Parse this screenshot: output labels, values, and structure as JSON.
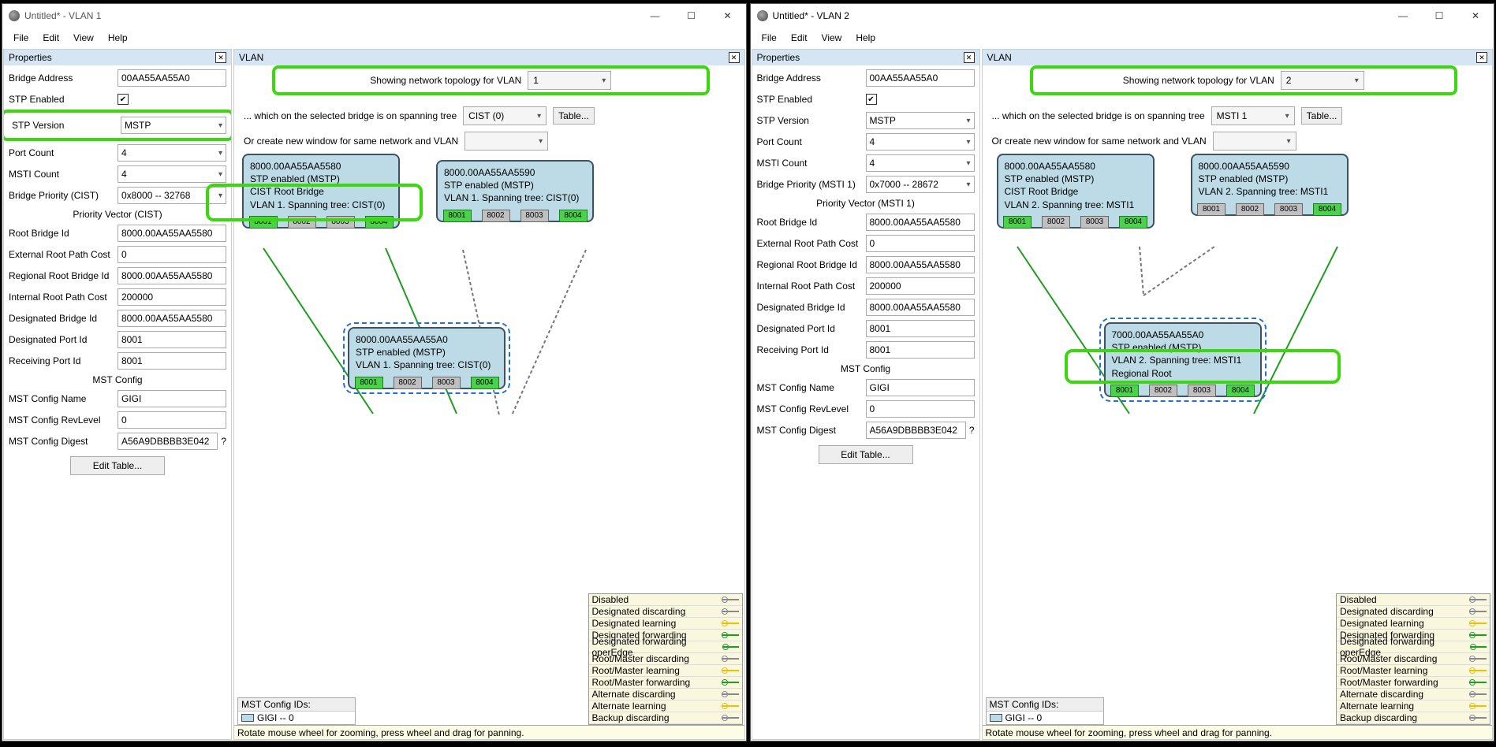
{
  "windows": [
    {
      "title": "Untitled* - VLAN 1",
      "menu": [
        "File",
        "Edit",
        "View",
        "Help"
      ],
      "props_header": "Properties",
      "vlan_header": "VLAN",
      "props": {
        "bridge_address_label": "Bridge Address",
        "bridge_address": "00AA55AA55A0",
        "stp_enabled_label": "STP Enabled",
        "stp_enabled": true,
        "stp_version_label": "STP Version",
        "stp_version": "MSTP",
        "port_count_label": "Port Count",
        "port_count": "4",
        "msti_count_label": "MSTI Count",
        "msti_count": "4",
        "bridge_priority_label": "Bridge Priority (CIST)",
        "bridge_priority": "0x8000 -- 32768",
        "pv_section": "Priority Vector (CIST)",
        "root_bridge_id_label": "Root Bridge Id",
        "root_bridge_id": "8000.00AA55AA5580",
        "ext_root_path_label": "External Root Path Cost",
        "ext_root_path": "0",
        "reg_root_label": "Regional Root Bridge Id",
        "reg_root": "8000.00AA55AA5580",
        "int_root_label": "Internal Root Path Cost",
        "int_root": "200000",
        "des_bridge_label": "Designated Bridge Id",
        "des_bridge": "8000.00AA55AA5580",
        "des_port_label": "Designated Port Id",
        "des_port": "8001",
        "recv_port_label": "Receiving Port Id",
        "recv_port": "8001",
        "mst_section": "MST Config",
        "mst_name_label": "MST Config Name",
        "mst_name": "GIGI",
        "mst_rev_label": "MST Config RevLevel",
        "mst_rev": "0",
        "mst_digest_label": "MST Config Digest",
        "mst_digest": "A56A9DBBBB3E042",
        "edit_table": "Edit Table..."
      },
      "vlan": {
        "topline": "Showing network topology for VLAN",
        "vlan_value": "1",
        "spanline": "... which on the selected bridge is on spanning tree",
        "span_value": "CIST (0)",
        "table_btn": "Table...",
        "newwin": "Or create new window for same network and VLAN",
        "mst_ids_label": "MST Config IDs:",
        "mst_id_item": "GIGI -- 0",
        "statusbar": "Rotate mouse wheel for zooming, press wheel and drag for panning."
      },
      "nodes": {
        "n1": {
          "l1": "8000.00AA55AA5580",
          "l2": "STP enabled (MSTP)",
          "l3": "CIST Root Bridge",
          "l4": "VLAN 1. Spanning tree: CIST(0)"
        },
        "n2": {
          "l1": "8000.00AA55AA5590",
          "l2": "STP enabled (MSTP)",
          "l3": "VLAN 1. Spanning tree: CIST(0)"
        },
        "n3": {
          "l1": "8000.00AA55AA55A0",
          "l2": "STP enabled (MSTP)",
          "l3": "VLAN 1. Spanning tree: CIST(0)"
        }
      }
    },
    {
      "title": "Untitled* - VLAN 2",
      "menu": [
        "File",
        "Edit",
        "View",
        "Help"
      ],
      "props_header": "Properties",
      "vlan_header": "VLAN",
      "props": {
        "bridge_address_label": "Bridge Address",
        "bridge_address": "00AA55AA55A0",
        "stp_enabled_label": "STP Enabled",
        "stp_enabled": true,
        "stp_version_label": "STP Version",
        "stp_version": "MSTP",
        "port_count_label": "Port Count",
        "port_count": "4",
        "msti_count_label": "MSTI Count",
        "msti_count": "4",
        "bridge_priority_label": "Bridge Priority (MSTI 1)",
        "bridge_priority": "0x7000 -- 28672",
        "pv_section": "Priority Vector (MSTI 1)",
        "root_bridge_id_label": "Root Bridge Id",
        "root_bridge_id": "8000.00AA55AA5580",
        "ext_root_path_label": "External Root Path Cost",
        "ext_root_path": "0",
        "reg_root_label": "Regional Root Bridge Id",
        "reg_root": "8000.00AA55AA5580",
        "int_root_label": "Internal Root Path Cost",
        "int_root": "200000",
        "des_bridge_label": "Designated Bridge Id",
        "des_bridge": "8000.00AA55AA5580",
        "des_port_label": "Designated Port Id",
        "des_port": "8001",
        "recv_port_label": "Receiving Port Id",
        "recv_port": "8001",
        "mst_section": "MST Config",
        "mst_name_label": "MST Config Name",
        "mst_name": "GIGI",
        "mst_rev_label": "MST Config RevLevel",
        "mst_rev": "0",
        "mst_digest_label": "MST Config Digest",
        "mst_digest": "A56A9DBBBB3E042",
        "edit_table": "Edit Table..."
      },
      "vlan": {
        "topline": "Showing network topology for VLAN",
        "vlan_value": "2",
        "spanline": "... which on the selected bridge is on spanning tree",
        "span_value": "MSTI 1",
        "table_btn": "Table...",
        "newwin": "Or create new window for same network and VLAN",
        "mst_ids_label": "MST Config IDs:",
        "mst_id_item": "GIGI -- 0",
        "statusbar": "Rotate mouse wheel for zooming, press wheel and drag for panning."
      },
      "nodes": {
        "n1": {
          "l1": "8000.00AA55AA5580",
          "l2": "STP enabled (MSTP)",
          "l3": "CIST Root Bridge",
          "l4": "VLAN 2. Spanning tree: MSTI1"
        },
        "n2": {
          "l1": "8000.00AA55AA5590",
          "l2": "STP enabled (MSTP)",
          "l3": "VLAN 2. Spanning tree: MSTI1"
        },
        "n3": {
          "l1": "7000.00AA55AA55A0",
          "l2": "STP enabled (MSTP)",
          "l3": "VLAN 2. Spanning tree: MSTI1",
          "l4": "Regional Root"
        }
      }
    }
  ],
  "ports": [
    "8001",
    "8002",
    "8003",
    "8004"
  ],
  "legend": [
    {
      "t": "Disabled",
      "c": "#888"
    },
    {
      "t": "Designated discarding",
      "c": "#888"
    },
    {
      "t": "Designated learning",
      "c": "#f0c000"
    },
    {
      "t": "Designated forwarding",
      "c": "#1e9e1e"
    },
    {
      "t": "Designated forwarding operEdge",
      "c": "#1e9e1e"
    },
    {
      "t": "Root/Master discarding",
      "c": "#888"
    },
    {
      "t": "Root/Master learning",
      "c": "#f0c000"
    },
    {
      "t": "Root/Master forwarding",
      "c": "#1e9e1e"
    },
    {
      "t": "Alternate discarding",
      "c": "#888"
    },
    {
      "t": "Alternate learning",
      "c": "#f0c000"
    },
    {
      "t": "Backup discarding",
      "c": "#888"
    }
  ],
  "highlight_color": "#3cd80e"
}
